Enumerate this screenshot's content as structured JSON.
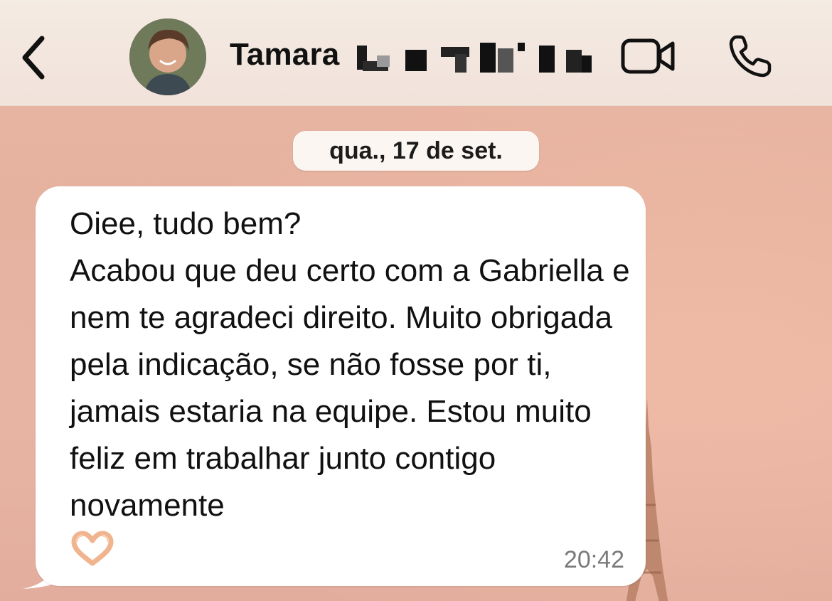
{
  "header": {
    "contact_name": "Tamara",
    "back_icon": "chevron-left-icon",
    "video_icon": "video-camera-icon",
    "call_icon": "phone-icon",
    "background_color": "#f3e6df"
  },
  "chat": {
    "date_label": "qua., 17 de set.",
    "messages": [
      {
        "text": "Oiee, tudo bem?\nAcabou que deu certo com a Gabriella e nem te agradeci direito. Muito obrigada pela indicação, se não fosse por ti, jamais estaria na equipe. Estou muito feliz em trabalhar junto contigo novamente",
        "emoji": "heart-hands-emoji",
        "time": "20:42",
        "direction": "incoming"
      }
    ],
    "wallpaper_color": "#e6b3a1",
    "bubble_color": "#ffffff"
  }
}
